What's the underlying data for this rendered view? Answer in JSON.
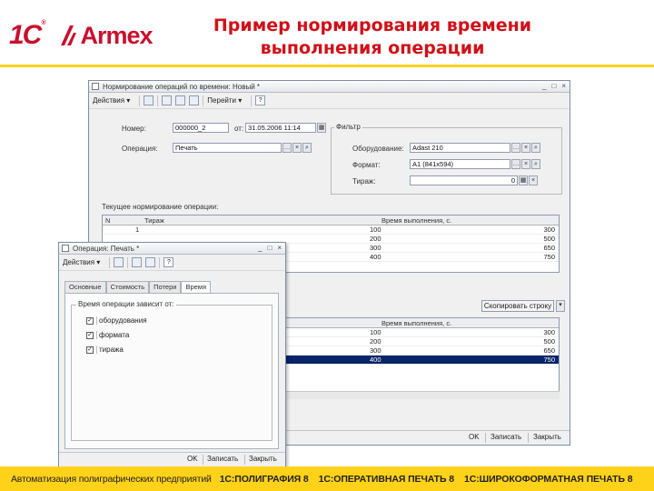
{
  "brand": {
    "logo_1c": "1С",
    "logo_1c_reg": "®",
    "logo_armex": "Armex"
  },
  "slide": {
    "title_line1": "Пример нормирования времени",
    "title_line2": "выполнения операции"
  },
  "back_window": {
    "title": "Нормирование операций по времени: Новый *",
    "controls": [
      "_",
      "□",
      "×"
    ],
    "toolbar": {
      "actions_label": "Действия ▾",
      "go_label": "Перейти ▾",
      "help_label": "?"
    },
    "fields": {
      "number_label": "Номер:",
      "number_value": "000000_2",
      "date_label": "от:",
      "date_value": "31.05.2006 11:14",
      "operation_label": "Операция:",
      "operation_value": "Печать"
    },
    "filter": {
      "title": "Фильтр",
      "equipment_label": "Оборудование:",
      "equipment_value": "Adast 210",
      "format_label": "Формат:",
      "format_value": "А1 (841х594)",
      "run_label": "Тираж:",
      "run_value": "0"
    },
    "current_label": "Текущее нормирование операции:",
    "table1": {
      "col_n": "N",
      "col_run": "Тираж",
      "col_time": "Время выполнения, с.",
      "rows": [
        {
          "n": "1",
          "run": "100",
          "time": "300"
        },
        {
          "n": "",
          "run": "200",
          "time": "500"
        },
        {
          "n": "",
          "run": "300",
          "time": "650"
        },
        {
          "n": "",
          "run": "400",
          "time": "750"
        }
      ]
    },
    "copy_button": "Скопировать строку",
    "table2": {
      "col_time": "Время выполнения, с.",
      "rows": [
        {
          "run": "100",
          "time": "300"
        },
        {
          "run": "200",
          "time": "500"
        },
        {
          "run": "300",
          "time": "650"
        },
        {
          "run": "400",
          "time": "750"
        }
      ]
    },
    "status": {
      "ok": "OK",
      "save": "Записать",
      "close": "Закрыть"
    }
  },
  "front_window": {
    "title": "Операция: Печать *",
    "controls": [
      "_",
      "□",
      "×"
    ],
    "toolbar": {
      "actions_label": "Действия ▾",
      "help_label": "?"
    },
    "tabs": [
      "Основные",
      "Стоимость",
      "Потери",
      "Время"
    ],
    "group_title": "Время операции зависит от:",
    "checks": [
      {
        "label": "оборудования",
        "checked": true
      },
      {
        "label": "формата",
        "checked": true
      },
      {
        "label": "тиража",
        "checked": true
      }
    ],
    "status": {
      "ok": "OK",
      "save": "Записать",
      "close": "Закрыть"
    }
  },
  "footer": {
    "text": "Автоматизация полиграфических предприятий",
    "items": [
      "1С:ПОЛИГРАФИЯ 8",
      "1С:ОПЕРАТИВНАЯ ПЕЧАТЬ 8",
      "1С:ШИРОКОФОРМАТНАЯ ПЕЧАТЬ 8"
    ]
  },
  "colors": {
    "accent_red": "#d01018",
    "brand_yellow": "#ffd21a",
    "selection": "#0a246a"
  }
}
